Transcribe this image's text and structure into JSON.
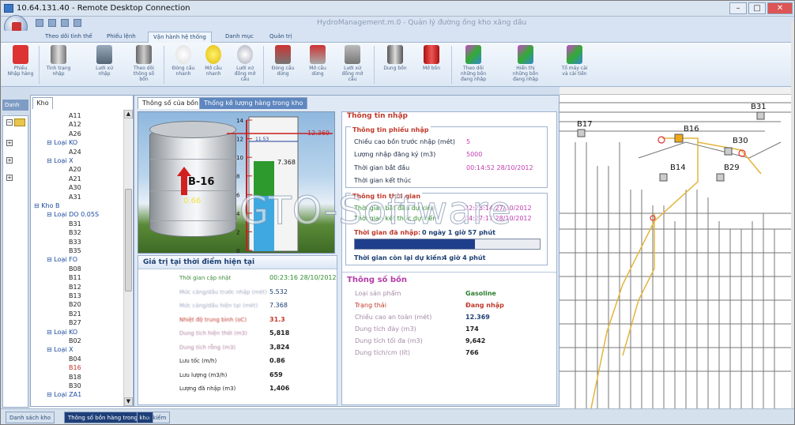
{
  "window": {
    "title": "10.64.131.40 - Remote Desktop Connection",
    "min": "–",
    "max": "□",
    "close": "✕"
  },
  "app": {
    "title": "HydroManagement.m.0 - Quản lý đường ống kho xăng dầu"
  },
  "ribbon": {
    "tabs": [
      "Theo dõi tình thế",
      "Phiếu lệnh",
      "Vận hành hệ thống",
      "Danh mục",
      "Quản trị"
    ],
    "active_tab": "Vận hành hệ thống",
    "buttons": [
      "Phiếu Nhập hàng",
      "Tình trạng nhập",
      "Lưới xử nhập",
      "Theo dõi thông số bồn",
      "Đóng cầu nhanh",
      "Mở cầu nhanh",
      "Lưới xử đồng mở cầu",
      "Đóng cầu dừng",
      "Mở cầu dừng",
      "Lưới xử đồng mở cầu",
      "Dung bồn",
      "Mở bồn",
      "Theo dõi những bồn đang nhập",
      "Hiển thị những bồn đang nhập",
      "Tổ máy cài và cài tiền"
    ]
  },
  "left_dock": {
    "tab": "Danh s..."
  },
  "kho": {
    "tab": "Kho",
    "tree": [
      {
        "label": "A11",
        "level": 2
      },
      {
        "label": "A12",
        "level": 2
      },
      {
        "label": "A26",
        "level": 2
      },
      {
        "label": "Loại KO",
        "level": 1,
        "group": true
      },
      {
        "label": "A24",
        "level": 2
      },
      {
        "label": "Loại X",
        "level": 1,
        "group": true
      },
      {
        "label": "A20",
        "level": 2
      },
      {
        "label": "A21",
        "level": 2
      },
      {
        "label": "A30",
        "level": 2
      },
      {
        "label": "A31",
        "level": 2
      },
      {
        "label": "Kho B",
        "level": 0,
        "group": true
      },
      {
        "label": "Loại DO 0.05S",
        "level": 1,
        "group": true
      },
      {
        "label": "B31",
        "level": 2
      },
      {
        "label": "B32",
        "level": 2
      },
      {
        "label": "B33",
        "level": 2
      },
      {
        "label": "B35",
        "level": 2
      },
      {
        "label": "Loại FO",
        "level": 1,
        "group": true
      },
      {
        "label": "B08",
        "level": 2
      },
      {
        "label": "B11",
        "level": 2
      },
      {
        "label": "B12",
        "level": 2
      },
      {
        "label": "B13",
        "level": 2
      },
      {
        "label": "B20",
        "level": 2
      },
      {
        "label": "B21",
        "level": 2
      },
      {
        "label": "B27",
        "level": 2
      },
      {
        "label": "Loại KO",
        "level": 1,
        "group": true
      },
      {
        "label": "B02",
        "level": 2
      },
      {
        "label": "Loại X",
        "level": 1,
        "group": true
      },
      {
        "label": "B04",
        "level": 2
      },
      {
        "label": "B16",
        "level": 2,
        "selected": true
      },
      {
        "label": "B18",
        "level": 2
      },
      {
        "label": "B30",
        "level": 2
      },
      {
        "label": "Loại ZA1",
        "level": 1,
        "group": true
      }
    ]
  },
  "main": {
    "tabs": [
      "Thông số của bồn",
      "Thống kê lượng hàng trong kho"
    ],
    "tank": {
      "name": "B-16",
      "percent": "0.66",
      "gauge_ticks": [
        "0",
        "2",
        "4",
        "6",
        "8",
        "10",
        "12",
        "14"
      ],
      "max_label": "12.369",
      "mid_label": "11.53",
      "level_label": "7.368"
    },
    "values": {
      "title": "Giá trị tại thời điểm hiện tại",
      "time": "00:23:16 28/10/2012",
      "rows": [
        {
          "label": "Thời gian cập nhật",
          "value": "00:23:16 28/10/2012"
        },
        {
          "label": "Mức cảng/dầu trước nhập (mét)",
          "value": "5.532"
        },
        {
          "label": "Mức cảng/dầu hiện tại (mét)",
          "value": "7.368"
        },
        {
          "label": "Nhiệt độ trung bình (oC)",
          "value": "31.3"
        },
        {
          "label": "Dung tích hiện thời (m3)",
          "value": "5,818"
        },
        {
          "label": "Dung tích rỗng (m3)",
          "value": "3,824"
        },
        {
          "label": "Lưu tốc (m/h)",
          "value": "0.86"
        },
        {
          "label": "Lưu lượng (m3/h)",
          "value": "659"
        },
        {
          "label": "Lượng đã nhập (m3)",
          "value": "1,406"
        }
      ]
    },
    "info": {
      "title": "Thông tin nhập",
      "phieu": {
        "title": "Thông tin phiếu nhập",
        "rows": [
          {
            "label": "Chiều cao bồn trước nhập (mét)",
            "value": "5"
          },
          {
            "label": "Lượng nhập đăng ký (m3)",
            "value": "5000"
          },
          {
            "label": "Thời gian bắt đầu",
            "value": "00:14:52 28/10/2012"
          },
          {
            "label": "Thời gian kết thúc",
            "value": ""
          }
        ]
      },
      "time": {
        "title": "Thông tin thời gian",
        "start_label": "Thời gian bắt đầu dự kiến",
        "start_value": "22:25:14 27/10/2012",
        "end_label": "Thời gian kết thúc dự kiến",
        "end_value": "04:27:17 28/10/2012",
        "elapsed_label": "Thời gian đã nhập:",
        "elapsed_value": "0 ngày 1 giờ 57 phút",
        "progress": 0.65,
        "remain_label": "Thời gian còn lại dự kiến:",
        "remain_value": "4 giờ 4 phút"
      }
    },
    "bon": {
      "title": "Thông số bồn",
      "rows": [
        {
          "label": "Loại sản phẩm",
          "value": "Gasoline",
          "color": "#2e7d2e"
        },
        {
          "label": "Trạng thái",
          "value": "Đang nhập",
          "color": "#c0392b"
        },
        {
          "label": "Chiều cao an toàn (mét)",
          "value": "12.369",
          "color": "#1c3f73"
        },
        {
          "label": "Dung tích đáy (m3)",
          "value": "174",
          "color": "#222"
        },
        {
          "label": "Dung tích tối đa (m3)",
          "value": "9,642",
          "color": "#222"
        },
        {
          "label": "Dung tích/cm (lít)",
          "value": "766",
          "color": "#222"
        }
      ]
    }
  },
  "map": {
    "labels": [
      "B31",
      "B17",
      "B16",
      "B30",
      "B14",
      "B29"
    ]
  },
  "watermark": "GTO-Software",
  "taskbar": {
    "items": [
      "Danh sách kho",
      "Thông số bồn hàng trong kho",
      "Tìm kiếm"
    ]
  }
}
